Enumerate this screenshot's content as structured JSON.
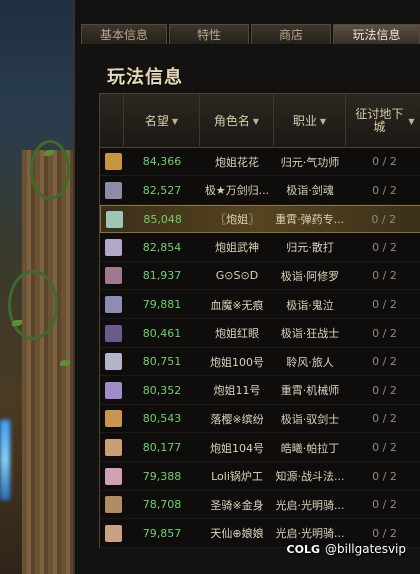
{
  "tabs": [
    {
      "label": "基本信息",
      "active": false
    },
    {
      "label": "特性",
      "active": false
    },
    {
      "label": "商店",
      "active": false
    },
    {
      "label": "玩法信息",
      "active": true
    }
  ],
  "panel_title": "玩法信息",
  "table": {
    "columns": [
      {
        "label": "名望",
        "sortable": true
      },
      {
        "label": "角色名",
        "sortable": true
      },
      {
        "label": "职业",
        "sortable": true
      },
      {
        "label": "征讨地下城",
        "sortable": true
      }
    ],
    "rows": [
      {
        "avatar_color": "#c8963c",
        "fame": "84,366",
        "name": "炮姐花花",
        "job": "归元·气功师",
        "raid": "0 / 2",
        "highlighted": false
      },
      {
        "avatar_color": "#8c8ca8",
        "fame": "82,527",
        "name": "极★万剑归...",
        "job": "极诣·剑魂",
        "raid": "0 / 2",
        "highlighted": false
      },
      {
        "avatar_color": "#9ec8b4",
        "fame": "85,048",
        "name": "〖炮姐〗",
        "job": "重霄·弹药专...",
        "raid": "0 / 2",
        "highlighted": true
      },
      {
        "avatar_color": "#b4a8c8",
        "fame": "82,854",
        "name": "炮姐武神",
        "job": "归元·散打",
        "raid": "0 / 2",
        "highlighted": false
      },
      {
        "avatar_color": "#a07890",
        "fame": "81,937",
        "name": "G⊙S⊙D",
        "job": "极诣·阿修罗",
        "raid": "0 / 2",
        "highlighted": false
      },
      {
        "avatar_color": "#8c8cb4",
        "fame": "79,881",
        "name": "血魔※无痕",
        "job": "极诣·鬼泣",
        "raid": "0 / 2",
        "highlighted": false
      },
      {
        "avatar_color": "#6c5a8c",
        "fame": "80,461",
        "name": "炮姐红眼",
        "job": "极诣·狂战士",
        "raid": "0 / 2",
        "highlighted": false
      },
      {
        "avatar_color": "#b4b4c8",
        "fame": "80,751",
        "name": "炮姐100号",
        "job": "聆风·旅人",
        "raid": "0 / 2",
        "highlighted": false
      },
      {
        "avatar_color": "#a08cc8",
        "fame": "80,352",
        "name": "炮姐11号",
        "job": "重霄·机械师",
        "raid": "0 / 2",
        "highlighted": false
      },
      {
        "avatar_color": "#c89650",
        "fame": "80,543",
        "name": "落樱※缤纷",
        "job": "极诣·驭剑士",
        "raid": "0 / 2",
        "highlighted": false
      },
      {
        "avatar_color": "#c8a078",
        "fame": "80,177",
        "name": "炮姐104号",
        "job": "皓曦·帕拉丁",
        "raid": "0 / 2",
        "highlighted": false
      },
      {
        "avatar_color": "#d2a0b4",
        "fame": "79,388",
        "name": "Loli锅炉工",
        "job": "知源·战斗法...",
        "raid": "0 / 2",
        "highlighted": false
      },
      {
        "avatar_color": "#b48c64",
        "fame": "78,708",
        "name": "圣骑※金身",
        "job": "光启·光明骑...",
        "raid": "0 / 2",
        "highlighted": false
      },
      {
        "avatar_color": "#c8a082",
        "fame": "79,857",
        "name": "天仙⊕娘娘",
        "job": "光启·光明骑...",
        "raid": "0 / 2",
        "highlighted": false
      }
    ]
  },
  "watermark": {
    "logo": "COLG",
    "text": "@billgatesvip"
  }
}
